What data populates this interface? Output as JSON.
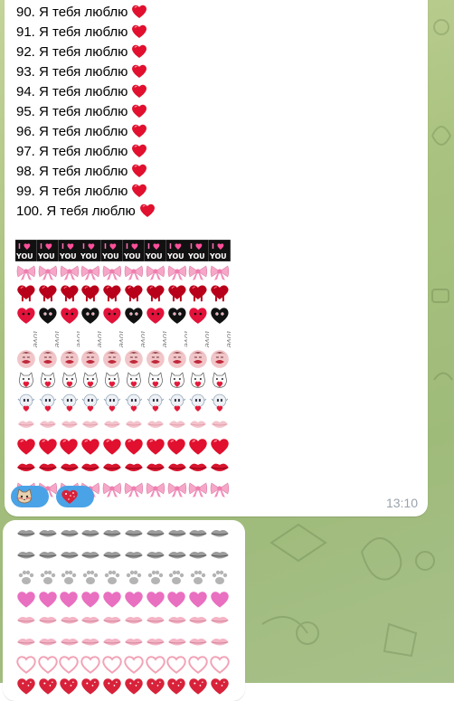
{
  "message_1": {
    "lines": [
      "90. Я тебя люблю",
      "91. Я тебя люблю",
      "92. Я тебя люблю",
      "93. Я тебя люблю",
      "94. Я тебя люблю",
      "95. Я тебя люблю",
      "96. Я тебя люблю",
      "97. Я тебя люблю",
      "98. Я тебя люблю",
      "99. Я тебя люблю",
      "100. Я тебя люблю"
    ],
    "line_emoji": "red-heart-emoji",
    "emoji_grid_rows": [
      "i-love-you-sticker",
      "pink-bow",
      "melting-red-heart",
      "red-and-black-heart",
      "love-text-sticker",
      "kissing-lips-portrait",
      "hugging-cat-heart",
      "shaking-face-heart",
      "pink-kiss",
      "red-heart",
      "red-kiss-lips",
      "pink-bow"
    ],
    "reactions": [
      "cat-emoji-reaction",
      "sparkle-heart-reaction"
    ],
    "time": "13:10"
  },
  "message_2": {
    "emoji_grid_rows": [
      "grey-lips",
      "grey-lips",
      "grey-paw",
      "pink-heart",
      "pink-lips",
      "pink-lips",
      "outlined-heart",
      "red-sparkle-heart"
    ]
  },
  "colors": {
    "bubble": "#ffffff",
    "reaction_chip": "#4aa3e6",
    "time": "#9aa3ab",
    "background": "#a8c17e",
    "heart": "#e0102e"
  }
}
